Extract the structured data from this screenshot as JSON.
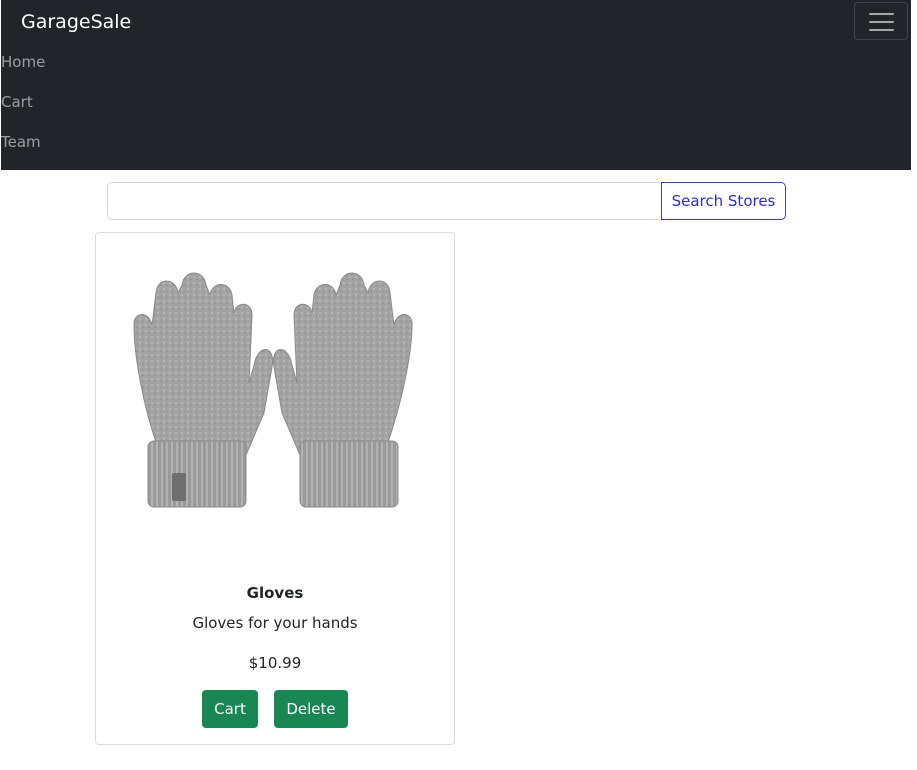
{
  "navbar": {
    "brand": "GarageSale",
    "items": [
      {
        "label": "Home"
      },
      {
        "label": "Cart"
      },
      {
        "label": "Team"
      }
    ],
    "toggler_icon": "hamburger-menu-icon",
    "background": "#212529"
  },
  "search": {
    "value": "",
    "placeholder": "",
    "button_label": "Search Stores",
    "button_color": "#2b2bd6"
  },
  "products": [
    {
      "image": "gloves-image",
      "title": "Gloves",
      "description": "Gloves for your hands",
      "price": "$10.99",
      "cart_label": "Cart",
      "delete_label": "Delete"
    }
  ],
  "colors": {
    "success": "#198754"
  }
}
